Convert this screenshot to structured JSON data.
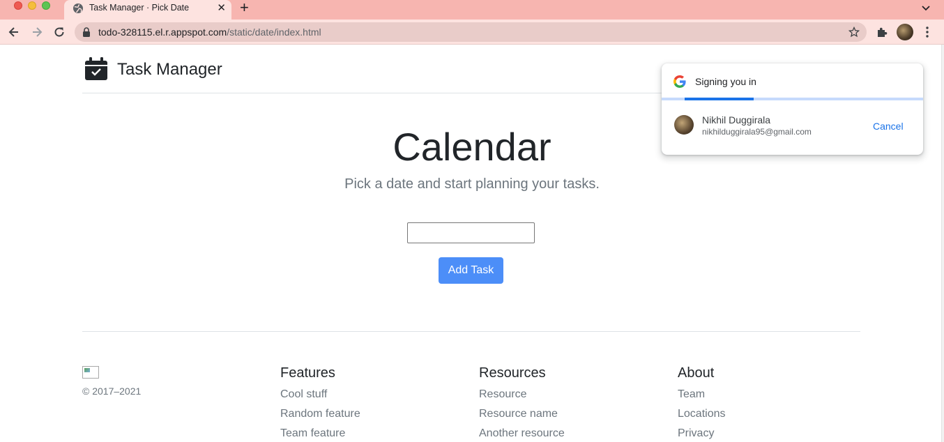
{
  "browser": {
    "tab_title": "Task Manager · Pick Date",
    "url_host": "todo-328115.el.r.appspot.com",
    "url_path": "/static/date/index.html"
  },
  "header": {
    "brand": "Task Manager"
  },
  "main": {
    "title": "Calendar",
    "subtitle": "Pick a date and start planning your tasks.",
    "date_value": "",
    "add_button": "Add Task"
  },
  "footer": {
    "copyright": "© 2017–2021",
    "columns": [
      {
        "heading": "Features",
        "links": [
          "Cool stuff",
          "Random feature",
          "Team feature"
        ]
      },
      {
        "heading": "Resources",
        "links": [
          "Resource",
          "Resource name",
          "Another resource"
        ]
      },
      {
        "heading": "About",
        "links": [
          "Team",
          "Locations",
          "Privacy"
        ]
      }
    ]
  },
  "signin_popup": {
    "title": "Signing you in",
    "name": "Nikhil Duggirala",
    "email": "nikhilduggirala95@gmail.com",
    "cancel": "Cancel",
    "progress": 0.26
  },
  "colors": {
    "tab_strip": "#f7b5b0",
    "toolbar": "#fde3e0",
    "primary_button": "#4c8ef8",
    "google_blue": "#1a73e8"
  }
}
